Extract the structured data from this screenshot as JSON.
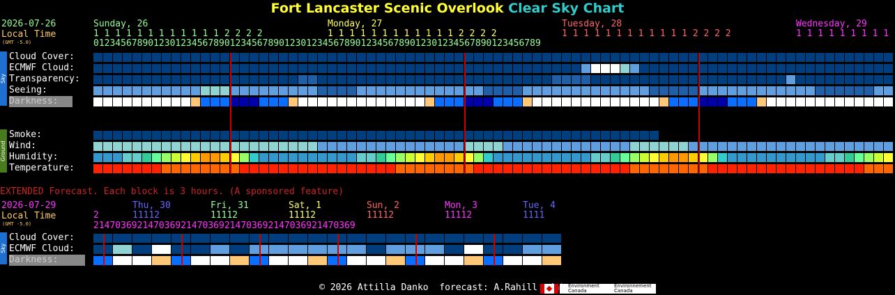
{
  "title": {
    "part1": "Fort Lancaster Scenic Overlook",
    "part2": "Clear Sky Chart"
  },
  "header": {
    "date": "2026-07-26",
    "local_time": "Local Time",
    "gmt": "(GMT -5.0)",
    "days": [
      {
        "label": "Sunday, 26",
        "color": "#99ff99"
      },
      {
        "label": "Monday, 27",
        "color": "#ffff66"
      },
      {
        "label": "Tuesday, 28",
        "color": "#ff6666"
      },
      {
        "label": "Wednesday, 29",
        "color": "#ff33ff"
      }
    ],
    "tens_row": [
      "1 1 1 1 1 1 1 1 1 1 1 1 2 2 2 2",
      "1 1 1 1 1 1 1 1 1 1 1 1 2 2 2 2",
      "1 1 1 1 1 1 1 1 1 1 1 1 2 2 2 2",
      "1 1 1 1 1 1 1 1 1 1"
    ],
    "ones_row": "0123456789012301234567890123456789012301234567890123456789012301234567890123456789"
  },
  "sky_label": "Sky",
  "ground_label": "Ground",
  "rows": {
    "cloud": "Cloud Cover:",
    "ecmwf": "ECMWF Cloud:",
    "transparency": "Transparency:",
    "seeing": "Seeing:",
    "darkness": "Darkness:",
    "smoke": "Smoke:",
    "wind": "Wind:",
    "humidity": "Humidity:",
    "temperature": "Temperature:"
  },
  "extended": {
    "notice": "EXTENDED Forecast. Each block is 3 hours. (A sponsored feature)",
    "date": "2026-07-29",
    "local_time": "Local Time",
    "gmt": "(GMT -5.0)",
    "days": [
      {
        "label": "Thu, 30",
        "color": "#6666ff"
      },
      {
        "label": "Fri, 31",
        "color": "#99ff99"
      },
      {
        "label": "Sat, 1",
        "color": "#ffff66"
      },
      {
        "label": "Sun, 2",
        "color": "#ff6666"
      },
      {
        "label": "Mon, 3",
        "color": "#ff33ff"
      },
      {
        "label": "Tue, 4",
        "color": "#6666ff"
      }
    ],
    "cloud": "Cloud Cover:",
    "ecmwf": "ECMWF Cloud:",
    "darkness": "Darkness:"
  },
  "footer": {
    "copyright": "© 2026 Attilla Danko  forecast: A.Rahill  data:",
    "logo_text": "Environment Canada"
  },
  "colors": {
    "dark_blue": "#003e7e",
    "mid_blue": "#2a6bb5",
    "light_blue": "#5f9fdf",
    "teal": "#8fd3d3",
    "red_line": "#cc0000"
  }
}
